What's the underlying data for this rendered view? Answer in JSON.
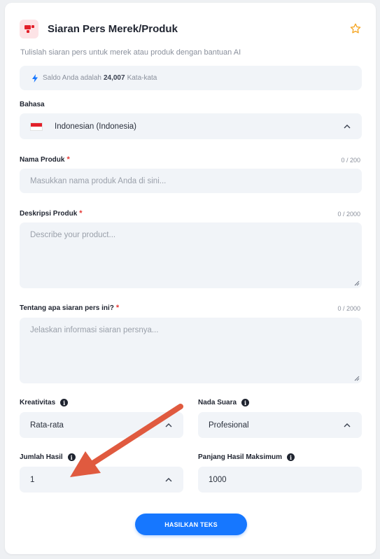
{
  "header": {
    "title": "Siaran Pers Merek/Produk",
    "subtitle": "Tulislah siaran pers untuk merek atau produk dengan bantuan AI"
  },
  "balance": {
    "prefix": "Saldo Anda adalah",
    "amount": "24,007",
    "suffix": "Kata-kata"
  },
  "language": {
    "label": "Bahasa",
    "value": "Indonesian (Indonesia)"
  },
  "product_name": {
    "label": "Nama Produk",
    "counter": "0 / 200",
    "placeholder": "Masukkan nama produk Anda di sini..."
  },
  "product_description": {
    "label": "Deskripsi Produk",
    "counter": "0 / 2000",
    "placeholder": "Describe your product..."
  },
  "press_topic": {
    "label": "Tentang apa siaran pers ini?",
    "counter": "0 / 2000",
    "placeholder": "Jelaskan informasi siaran persnya..."
  },
  "creativity": {
    "label": "Kreativitas",
    "value": "Rata-rata"
  },
  "tone": {
    "label": "Nada Suara",
    "value": "Profesional"
  },
  "result_count": {
    "label": "Jumlah Hasil",
    "value": "1"
  },
  "max_length": {
    "label": "Panjang Hasil Maksimum",
    "value": "1000"
  },
  "generate_button": {
    "label": "HASILKAN TEKS"
  },
  "colors": {
    "accent": "#1677ff",
    "required": "#e53935",
    "field_bg": "#f1f4f8",
    "annotation_arrow": "#e05a3f"
  }
}
